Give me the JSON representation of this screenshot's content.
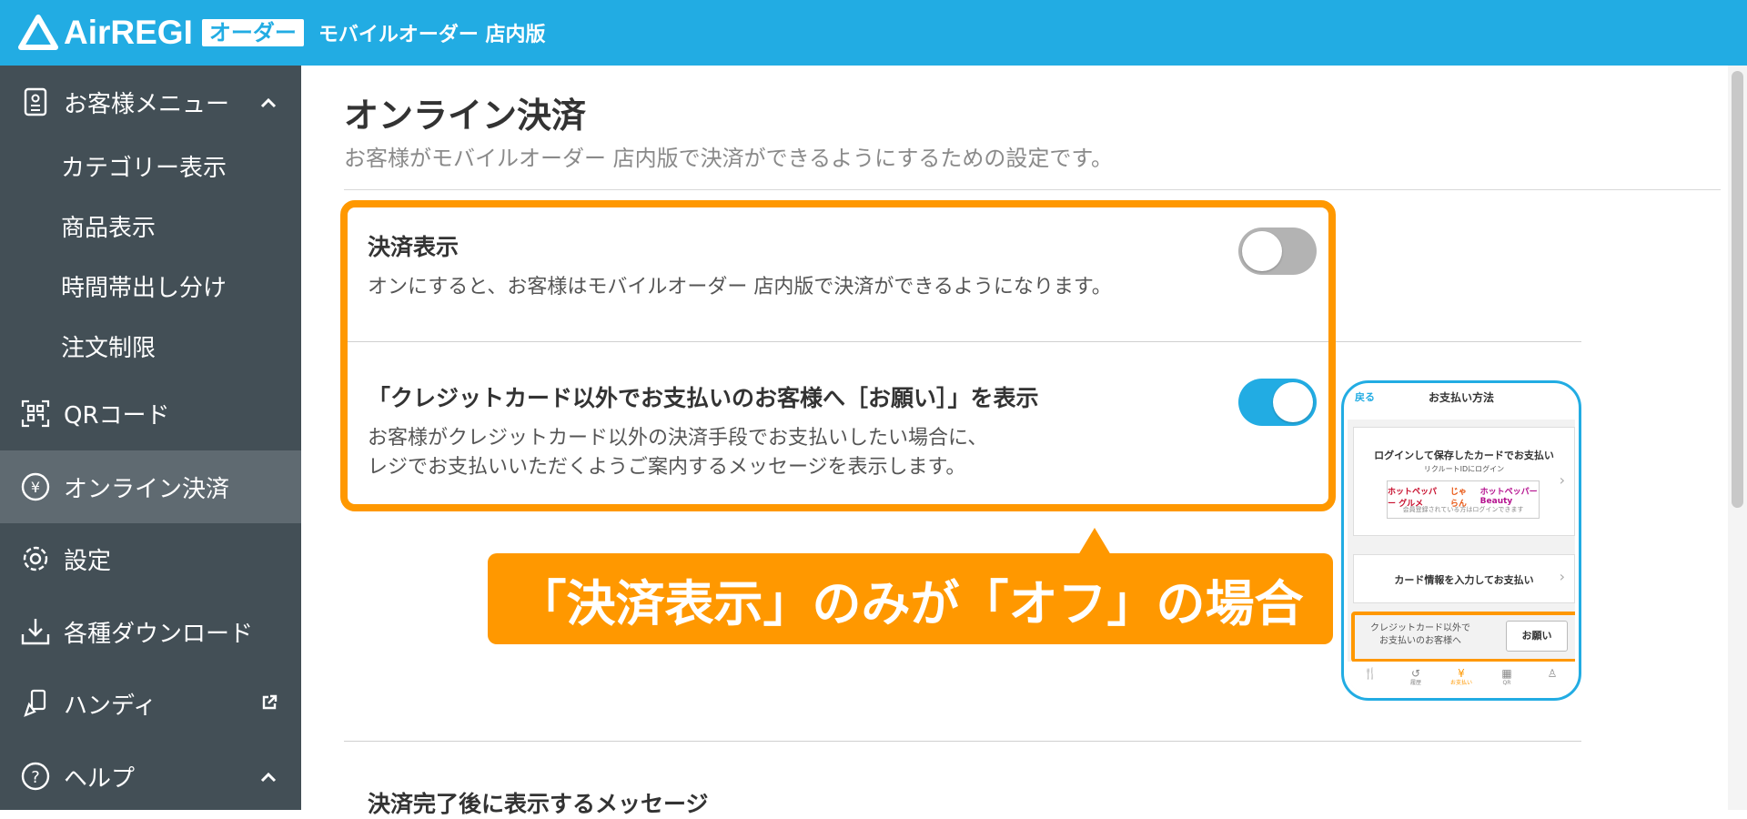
{
  "header": {
    "logo_text": "AirREGI",
    "logo_badge": "オーダー",
    "app_name": "モバイルオーダー 店内版",
    "bg_color": "#22ace3"
  },
  "sidebar": {
    "menu_group": {
      "label": "お客様メニュー",
      "icon": "menu-book-icon",
      "expanded": true
    },
    "sub_items": [
      "カテゴリー表示",
      "商品表示",
      "時間帯出し分け",
      "注文制限"
    ],
    "items": [
      {
        "label": "QRコード",
        "icon": "qr-code-icon"
      },
      {
        "label": "オンライン決済",
        "icon": "yen-circle-icon",
        "active": true
      },
      {
        "label": "設定",
        "icon": "gear-icon"
      },
      {
        "label": "各種ダウンロード",
        "icon": "download-icon"
      },
      {
        "label": "ハンディ",
        "icon": "handheld-device-icon",
        "external": true
      },
      {
        "label": "ヘルプ",
        "icon": "help-icon",
        "expanded": true
      }
    ]
  },
  "main": {
    "title": "オンライン決済",
    "description": "お客様がモバイルオーダー 店内版で決済ができるようにするための設定です。",
    "settings": [
      {
        "title": "決済表示",
        "desc_lines": [
          "オンにすると、お客様はモバイルオーダー 店内版で決済ができるようになります。"
        ],
        "toggle": "off"
      },
      {
        "title": "「クレジットカード以外でお支払いのお客様へ［お願い］」を表示",
        "desc_lines": [
          "お客様がクレジットカード以外の決済手段でお支払いしたい場合に、",
          "レジでお支払いいただくようご案内するメッセージを表示します。"
        ],
        "toggle": "on"
      }
    ],
    "callout": "「決済表示」のみが「オフ」の場合",
    "next_section_title": "決済完了後に表示するメッセージ",
    "highlight_color": "#ff9800"
  },
  "phone_preview": {
    "back": "戻る",
    "title": "お支払い方法",
    "card1_title": "ログインして保存したカードでお支払い",
    "card1_sub": "リクルートIDにログイン",
    "brands": [
      "ホットペッパー グルメ",
      "じゃらん",
      "ホットペッパー Beauty"
    ],
    "brand_note": "会員登録されている方はログインできます",
    "card2_title": "カード情報を入力してお支払い",
    "notice_text_lines": [
      "クレジットカード以外で",
      "お支払いのお客様へ"
    ],
    "notice_button": "お願い",
    "tabs": [
      {
        "icon": "fork-knife-icon",
        "label": ""
      },
      {
        "icon": "history-icon",
        "label": "履歴"
      },
      {
        "icon": "yen-icon",
        "label": "お支払い"
      },
      {
        "icon": "qr-code-icon",
        "label": "QR"
      },
      {
        "icon": "person-icon",
        "label": ""
      }
    ]
  }
}
